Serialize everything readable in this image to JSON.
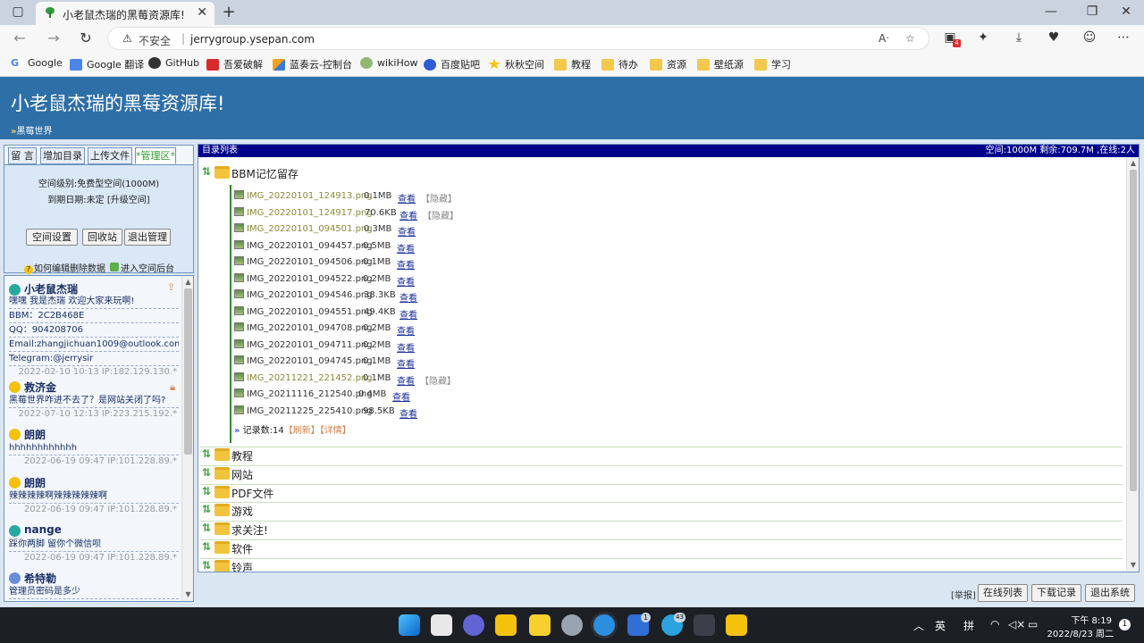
{
  "browser": {
    "tab_title": "小老鼠杰瑞的黑莓资源库!",
    "security_label": "不安全",
    "url": "jerrygroup.ysepan.com",
    "extension_badge": "4",
    "bookmarks": [
      "Google",
      "Google 翻译",
      "GitHub",
      "吾爱破解",
      "蓝奏云-控制台",
      "wikiHow",
      "百度贴吧",
      "秋秋空间",
      "教程",
      "待办",
      "资源",
      "壁纸源",
      "学习"
    ]
  },
  "site": {
    "title": "小老鼠杰瑞的黑莓资源库!",
    "crumb_prefix": "»",
    "crumb": "黑莓世界"
  },
  "left_tabs": [
    "留 言",
    "增加目录",
    "上传文件",
    "*管理区*"
  ],
  "mgmt": {
    "space_level": "空间级别:免费型空间(1000M)",
    "expire": "到期日期:未定 [升级空间]",
    "btn_settings": "空间设置",
    "btn_recycle": "回收站",
    "btn_logout": "退出管理",
    "help1": "如何编辑删除数据",
    "help2": "进入空间后台"
  },
  "guestbook": [
    {
      "name": "小老鼠杰瑞",
      "lines": [
        "嘿嘿 我是杰瑞 欢迎大家来玩啊!",
        "BBM：2C2B468E",
        "QQ：904208706",
        "Email:zhangjichuan1009@outlook.com",
        "Telegram:@jerrysir"
      ],
      "meta": "2022-02-10 10:13 IP:182.129.130.*"
    },
    {
      "name": "救济金",
      "lines": [
        "黑莓世界咋进不去了？是网站关闭了吗?"
      ],
      "meta": "2022-07-10 12:13 IP:223.215.192.*"
    },
    {
      "name": "朗朗",
      "lines": [
        "hhhhhhhhhhhh"
      ],
      "meta": "2022-06-19 09:47 IP:101.228.89.*"
    },
    {
      "name": "朗朗",
      "lines": [
        "辣辣辣辣啊辣辣辣辣辣啊"
      ],
      "meta": "2022-06-19 09:47 IP:101.228.89.*"
    },
    {
      "name": "nange",
      "lines": [
        "踩你两脚 留你个微信呗"
      ],
      "meta": "2022-06-19 09:47 IP:101.228.89.*"
    },
    {
      "name": "希特勒",
      "lines": [
        "管理员密码是多少"
      ],
      "meta": ""
    }
  ],
  "main": {
    "header_left": "目录列表",
    "header_right": "空间:1000M 剩余:709.7M ,在线:2人",
    "open_dir": "BBM记忆留存",
    "view_label": "查看",
    "hidden_label": "【隐藏】",
    "files": [
      {
        "name": "IMG_20220101_124913.png",
        "size": "0.1MB",
        "hidden": true
      },
      {
        "name": "IMG_20220101_124917.png",
        "size": "70.6KB",
        "hidden": true
      },
      {
        "name": "IMG_20220101_094501.png",
        "size": "0.3MB",
        "hidden": false,
        "olive": true
      },
      {
        "name": "IMG_20220101_094457.png",
        "size": "0.5MB",
        "hidden": false
      },
      {
        "name": "IMG_20220101_094506.png",
        "size": "0.1MB",
        "hidden": false
      },
      {
        "name": "IMG_20220101_094522.png",
        "size": "0.2MB",
        "hidden": false
      },
      {
        "name": "IMG_20220101_094546.png",
        "size": "38.3KB",
        "hidden": false
      },
      {
        "name": "IMG_20220101_094551.png",
        "size": "49.4KB",
        "hidden": false
      },
      {
        "name": "IMG_20220101_094708.png",
        "size": "0.2MB",
        "hidden": false
      },
      {
        "name": "IMG_20220101_094711.png",
        "size": "0.2MB",
        "hidden": false
      },
      {
        "name": "IMG_20220101_094745.png",
        "size": "0.1MB",
        "hidden": false
      },
      {
        "name": "IMG_20211221_221452.png",
        "size": "0.1MB",
        "hidden": true
      },
      {
        "name": "IMG_20211116_212540.png",
        "size": "0.4MB",
        "hidden": false
      },
      {
        "name": "IMG_20211225_225410.png",
        "size": "98.5KB",
        "hidden": false
      }
    ],
    "record_count": "记录数:14",
    "refresh": "【刷新】",
    "detail": "【详情】",
    "dirs": [
      "教程",
      "网站",
      "PDF文件",
      "游戏",
      "求关注!",
      "软件",
      "铃声"
    ]
  },
  "bottom": {
    "report": "[举报]",
    "online": "在线列表",
    "download": "下载记录",
    "exit": "退出系统"
  },
  "taskbar": {
    "ime1": "英",
    "ime2": "拼",
    "time": "下午 8:19",
    "date": "2022/8/23 周二",
    "notif": "1",
    "badge1": "1",
    "badge2": "43"
  }
}
